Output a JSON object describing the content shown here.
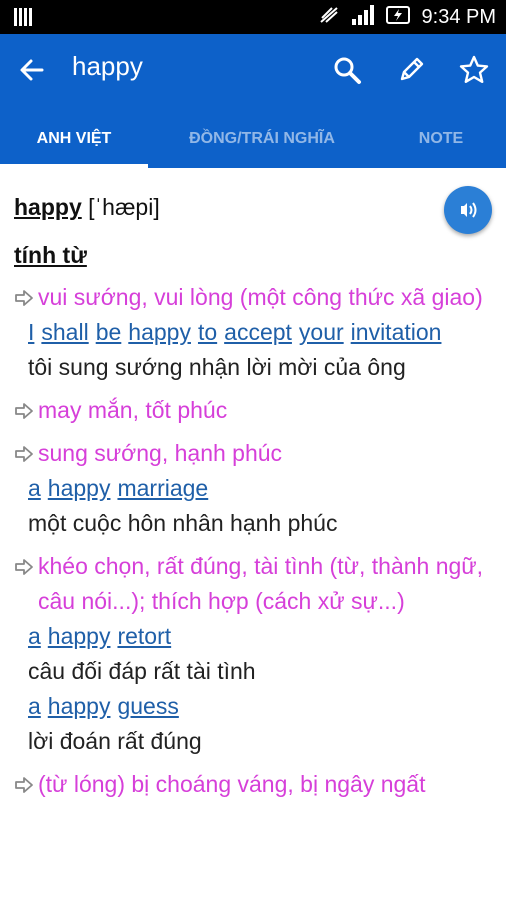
{
  "status_bar": {
    "time": "9:34 PM"
  },
  "app_bar": {
    "title": "happy"
  },
  "tabs": [
    {
      "label": "ANH VIỆT"
    },
    {
      "label": "ĐỒNG/TRÁI NGHĨA"
    },
    {
      "label": "NOTE"
    }
  ],
  "entry": {
    "word": "happy",
    "pronunciation": "[ˈhæpi]",
    "part_of_speech": "tính từ",
    "definitions": [
      {
        "meaning": "vui sướng, vui lòng (một công thức xã giao)",
        "examples": [
          {
            "en": [
              "I",
              "shall",
              "be",
              "happy",
              "to",
              "accept",
              "your",
              "invitation"
            ],
            "vi": "tôi sung sướng nhận lời mời của ông"
          }
        ]
      },
      {
        "meaning": "may mắn, tốt phúc",
        "examples": []
      },
      {
        "meaning": "sung sướng, hạnh phúc",
        "examples": [
          {
            "en": [
              "a",
              "happy",
              "marriage"
            ],
            "vi": "một cuộc hôn nhân hạnh phúc"
          }
        ]
      },
      {
        "meaning": "khéo chọn, rất đúng, tài tình (từ, thành ngữ, câu nói...); thích hợp (cách xử sự...)",
        "examples": [
          {
            "en": [
              "a",
              "happy",
              "retort"
            ],
            "vi": "câu đối đáp rất tài tình"
          },
          {
            "en": [
              "a",
              "happy",
              "guess"
            ],
            "vi": "lời đoán rất đúng"
          }
        ]
      },
      {
        "meaning": "(từ lóng) bị choáng váng, bị ngây ngất",
        "examples": []
      }
    ]
  },
  "colors": {
    "app_bar": "#0d61c9",
    "meaning": "#d63fd9",
    "example_link": "#1f5fa8",
    "speaker": "#2b7fd6"
  },
  "icons": {
    "back": "arrow-left-icon",
    "search": "search-icon",
    "edit": "pencil-icon",
    "favorite": "star-icon",
    "speak": "speaker-icon"
  }
}
